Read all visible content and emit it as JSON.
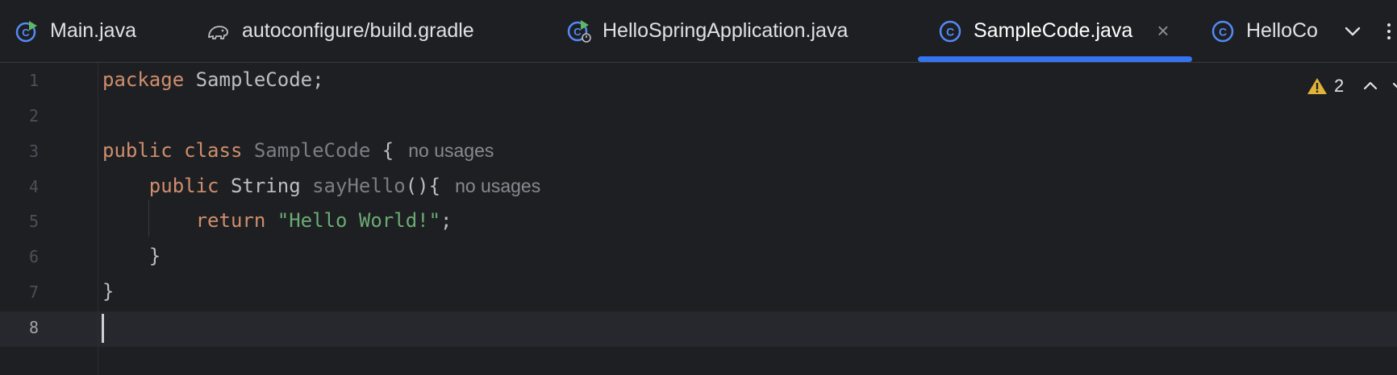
{
  "tabs": [
    {
      "label": "Main.java",
      "icon": "java-run-class-icon",
      "active": false
    },
    {
      "label": "autoconfigure/build.gradle",
      "icon": "gradle-elephant-icon",
      "active": false
    },
    {
      "label": "HelloSpringApplication.java",
      "icon": "spring-boot-app-icon",
      "active": false
    },
    {
      "label": "SampleCode.java",
      "icon": "java-class-icon",
      "active": true,
      "close": "×"
    },
    {
      "label": "HelloCo",
      "icon": "java-class-icon",
      "active": false
    }
  ],
  "inspections": {
    "warning_count": "2"
  },
  "code": {
    "line_numbers": [
      "1",
      "2",
      "3",
      "4",
      "5",
      "6",
      "7",
      "8"
    ],
    "current_line": "8",
    "l1_kw": "package",
    "l1_rest": " SampleCode;",
    "l3_kw": "public class",
    "l3_name": " SampleCode",
    "l3_rest": " {",
    "l3_hint": "no usages",
    "l4_indent": "    ",
    "l4_kw": "public",
    "l4_type": " String",
    "l4_method": " sayHello",
    "l4_rest": "(){",
    "l4_hint": "no usages",
    "l5_indent": "        ",
    "l5_kw": "return",
    "l5_str": " \"Hello World!\"",
    "l5_rest": ";",
    "l6_text": "    }",
    "l7_text": "}"
  },
  "colors": {
    "background": "#1e1f22",
    "keyword": "#cf8e6d",
    "string": "#6aab73",
    "accent": "#3574f0",
    "warning": "#e2b339"
  }
}
